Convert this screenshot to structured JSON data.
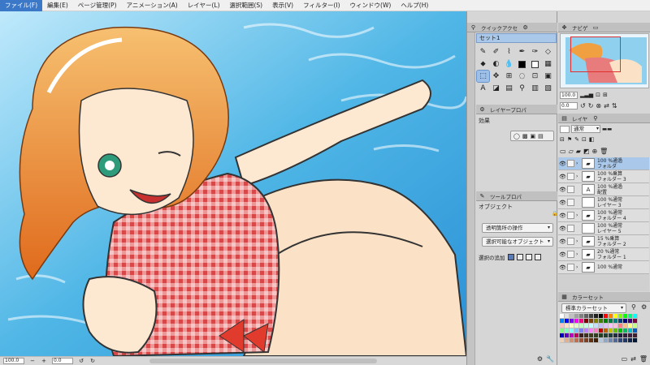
{
  "menu": [
    {
      "label": "ファイル(F)",
      "active": true
    },
    {
      "label": "編集(E)"
    },
    {
      "label": "ページ管理(P)"
    },
    {
      "label": "アニメーション(A)"
    },
    {
      "label": "レイヤー(L)"
    },
    {
      "label": "選択範囲(S)"
    },
    {
      "label": "表示(V)"
    },
    {
      "label": "フィルター(I)"
    },
    {
      "label": "ウィンドウ(W)"
    },
    {
      "label": "ヘルプ(H)"
    }
  ],
  "canvas_status": {
    "zoom": "100.0",
    "angle": "0.0"
  },
  "quick_access": {
    "tab_label": "クイックアクセ",
    "set_label": "セット1",
    "tools": [
      {
        "icon": "pen-icon",
        "glyph": "✎"
      },
      {
        "icon": "pencil-icon",
        "glyph": "✐"
      },
      {
        "icon": "brush-icon",
        "glyph": "⌇"
      },
      {
        "icon": "marker-icon",
        "glyph": "✒"
      },
      {
        "icon": "airbrush-icon",
        "glyph": "✑"
      },
      {
        "icon": "eraser-icon",
        "glyph": "◇"
      },
      {
        "icon": "fill-icon",
        "glyph": "⬥"
      },
      {
        "icon": "gradient-icon",
        "glyph": "◐"
      },
      {
        "icon": "droplet-icon",
        "glyph": "💧"
      },
      {
        "icon": "swatch-black",
        "glyph": ""
      },
      {
        "icon": "swatch-white",
        "glyph": ""
      },
      {
        "icon": "transparent-icon",
        "glyph": "▦"
      },
      {
        "icon": "select-icon",
        "glyph": "⬚"
      },
      {
        "icon": "move-icon",
        "glyph": "✥"
      },
      {
        "icon": "transform-icon",
        "glyph": "⊞"
      },
      {
        "icon": "lasso-icon",
        "glyph": "◌"
      },
      {
        "icon": "crop-icon",
        "glyph": "⊡"
      },
      {
        "icon": "frame-icon",
        "glyph": "▣"
      },
      {
        "icon": "text-icon",
        "glyph": "A"
      },
      {
        "icon": "shape-icon",
        "glyph": "◪"
      },
      {
        "icon": "ruler-icon",
        "glyph": "▤"
      },
      {
        "icon": "balloon-icon",
        "glyph": "⚲"
      },
      {
        "icon": "frame2-icon",
        "glyph": "▥"
      },
      {
        "icon": "more-icon",
        "glyph": "▧"
      }
    ]
  },
  "layer_property": {
    "tab_label": "レイヤープロパ",
    "effect_label": "効果"
  },
  "tool_property": {
    "tab_label": "ツールプロパ",
    "tool_name": "オブジェクト",
    "transparent_op": "透明箇所の操作",
    "selectable_obj": "選択可能なオブジェクト",
    "selection_add": "選択の追加"
  },
  "navigator": {
    "tab_label": "ナビゲ",
    "zoom": "100.0",
    "angle": "0.0"
  },
  "layers": {
    "tab_label": "レイヤ",
    "blend_mode": "通常",
    "items": [
      {
        "pct": "100 %通過",
        "name": "フォルダ",
        "kind": "folder",
        "selected": true
      },
      {
        "pct": "100 %乗算",
        "name": "フォルダー 3",
        "kind": "folder"
      },
      {
        "pct": "100 %通過",
        "name": "配置",
        "kind": "text"
      },
      {
        "pct": "100 %通常",
        "name": "レイヤー 3",
        "kind": "raster"
      },
      {
        "pct": "100 %通常",
        "name": "フォルダー 4",
        "kind": "folder"
      },
      {
        "pct": "100 %通常",
        "name": "レイヤー 5",
        "kind": "raster"
      },
      {
        "pct": "15 %乗算",
        "name": "フォルダー 2",
        "kind": "folder"
      },
      {
        "pct": "20 %通常",
        "name": "フォルダー 1",
        "kind": "folder"
      },
      {
        "pct": "100 %通常",
        "name": "",
        "kind": "folder"
      }
    ]
  },
  "color_set": {
    "tab_label": "カラーセット",
    "set_name": "標準カラーセット"
  }
}
